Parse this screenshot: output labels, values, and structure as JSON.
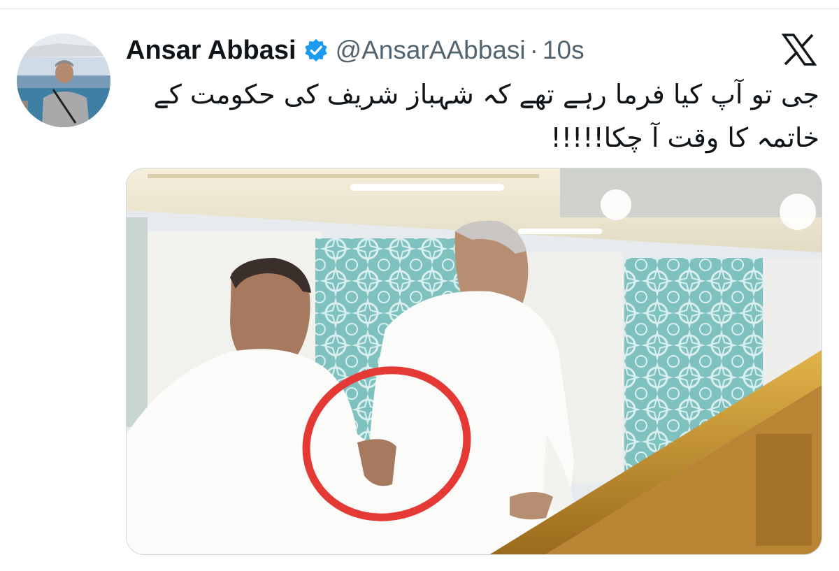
{
  "author": {
    "display_name": "Ansar Abbasi",
    "verified": true,
    "handle": "@AnsarAAbbasi",
    "separator": "·",
    "time": "10s"
  },
  "tweet": {
    "text": "جی تو آپ کیا فرما رہے تھے کہ شہباز شریف کی حکومت کے خاتمہ کا وقت آ چکا!!!!!",
    "text_dir": "rtl"
  },
  "icons": {
    "verified": "verified-badge-icon",
    "brand": "x-logo-icon"
  },
  "colors": {
    "text_primary": "#0f1419",
    "text_secondary": "#536471",
    "verified_blue": "#1d9bf0",
    "annotation_red": "#e53935"
  }
}
